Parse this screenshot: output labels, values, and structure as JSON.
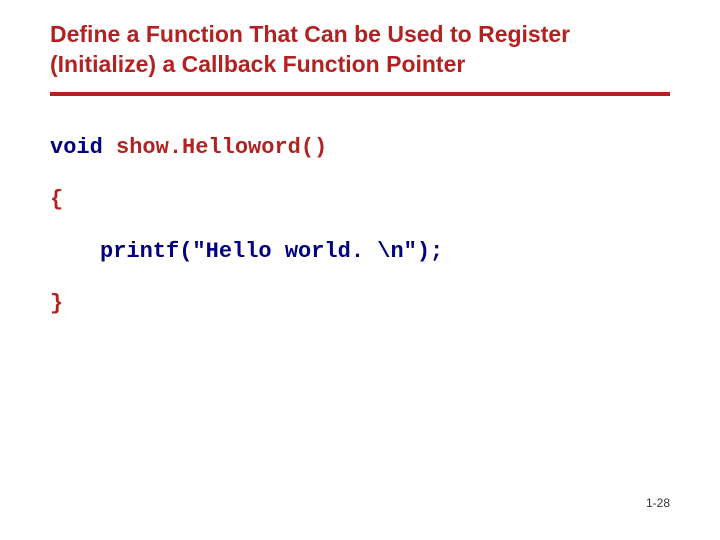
{
  "title": "Define a Function That Can be Used to Register (Initialize) a Callback Function Pointer",
  "code": {
    "keyword": "void",
    "space": " ",
    "funcname": "show.Helloword",
    "parens": "()",
    "open_brace": "{",
    "printf_call": "printf(\"Hello world. \\n\");",
    "close_brace": "}"
  },
  "page_number": "1-28"
}
